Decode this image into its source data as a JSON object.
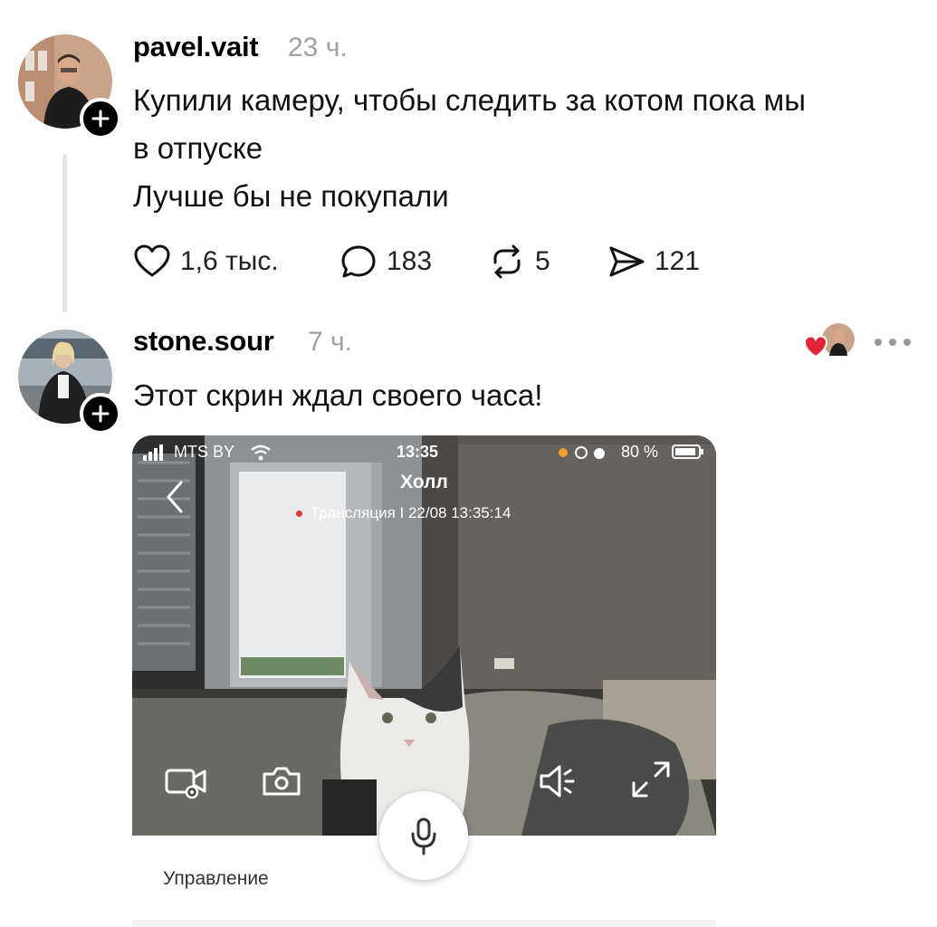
{
  "posts": [
    {
      "username": "pavel.vait",
      "time": "23 ч.",
      "text_line1": "Купили камеру, чтобы следить за котом пока мы",
      "text_line2": "в отпуске",
      "text_line3": "Лучше бы не покупали",
      "likes": "1,6 тыс.",
      "comments": "183",
      "reposts": "5",
      "shares": "121"
    },
    {
      "username": "stone.sour",
      "time": "7 ч.",
      "text": "Этот скрин ждал своего часа!"
    }
  ],
  "embedded_screenshot": {
    "carrier": "MTS BY",
    "clock": "13:35",
    "battery": "80 %",
    "camera_name": "Холл",
    "stream_status": "Трансляция I 22/08 13:35:14",
    "control_label": "Управление"
  },
  "colors": {
    "reaction_heart": "#e0243a",
    "muted_text": "#a0a0a0",
    "live_dot": "#e03a3a"
  },
  "icons": [
    "plus-icon",
    "heart-icon",
    "comment-icon",
    "repost-icon",
    "send-icon",
    "more-icon",
    "signal-icon",
    "wifi-icon",
    "back-icon",
    "record-video-icon",
    "camera-icon",
    "speaker-icon",
    "fullscreen-icon",
    "microphone-icon"
  ]
}
